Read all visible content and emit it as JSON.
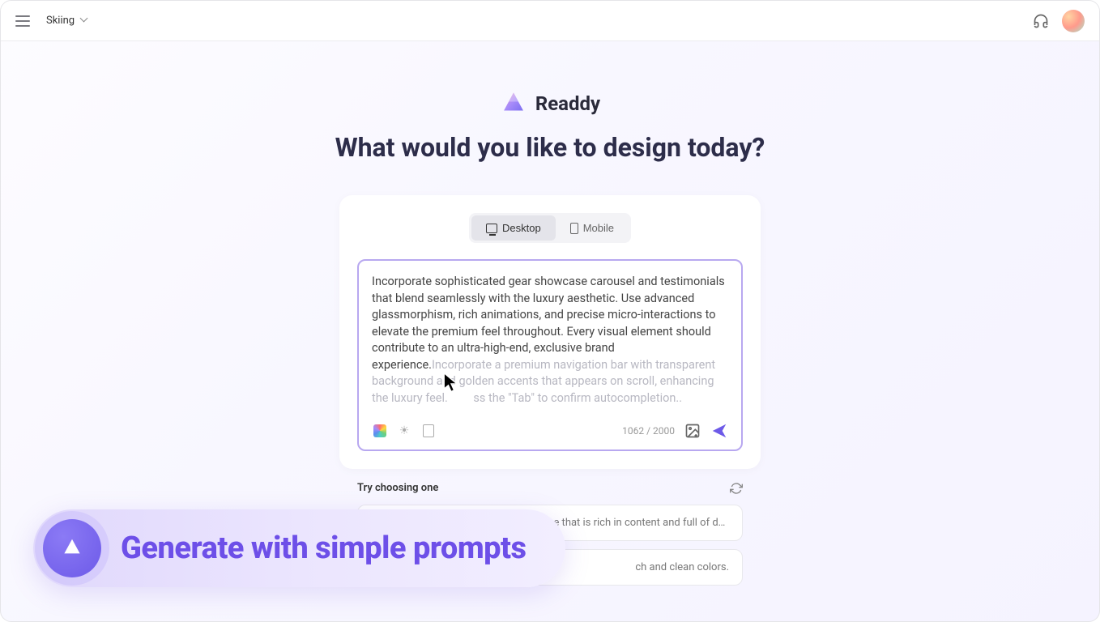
{
  "header": {
    "project_name": "Skiing"
  },
  "brand": {
    "name": "Readdy"
  },
  "headline": "What would you like to design today?",
  "deviceToggle": {
    "desktop": "Desktop",
    "mobile": "Mobile"
  },
  "prompt": {
    "text": "Incorporate sophisticated gear showcase carousel and testimonials that blend seamlessly with the luxury aesthetic. Use advanced glassmorphism, rich animations, and precise micro-interactions to elevate the premium feel throughout. Every visual element should contribute to an ultra-high-end, exclusive brand experience.",
    "ghost": "Incorporate a premium navigation bar with transparent background and golden accents that appears on scroll, enhancing the luxury feel. ",
    "ghost_hint": "ss the \"Tab\" to confirm autocompletion..",
    "char_count": "1062 / 2000"
  },
  "suggestions": {
    "title": "Try choosing one",
    "items": [
      "Design a modern social media page that is rich in content and full of detail, with a front ...",
      "ch and clean colors."
    ]
  },
  "overlay": {
    "text": "Generate with simple prompts"
  }
}
